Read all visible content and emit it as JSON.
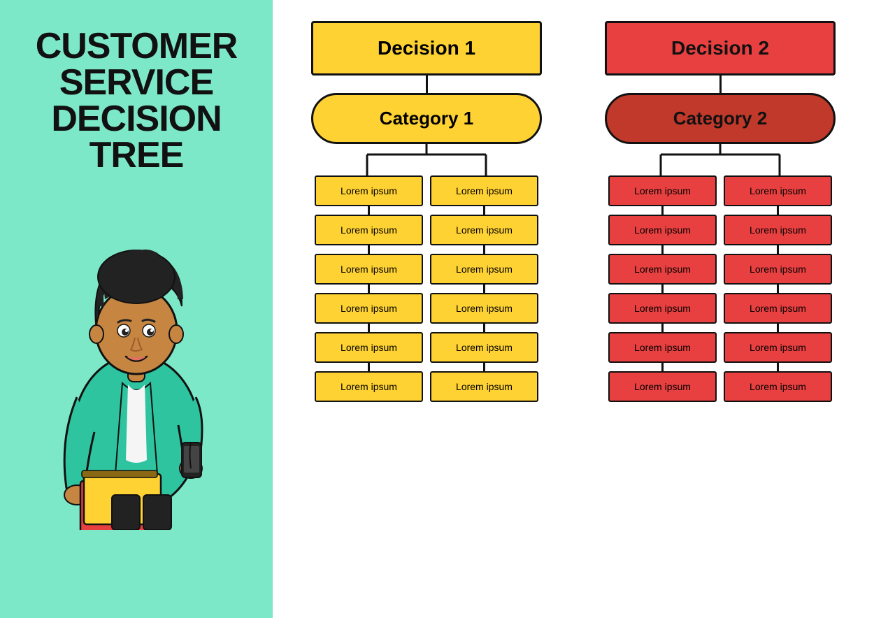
{
  "title": {
    "line1": "CUSTOMER",
    "line2": "SERVICE",
    "line3": "DECISION",
    "line4": "TREE"
  },
  "tree": {
    "decision1": {
      "label": "Decision 1",
      "category": "Category 1",
      "color": "yellow",
      "col1_items": [
        "Lorem ipsum",
        "Lorem ipsum",
        "Lorem ipsum",
        "Lorem ipsum",
        "Lorem ipsum",
        "Lorem ipsum"
      ],
      "col2_items": [
        "Lorem ipsum",
        "Lorem ipsum",
        "Lorem ipsum",
        "Lorem ipsum",
        "Lorem ipsum",
        "Lorem ipsum"
      ]
    },
    "decision2": {
      "label": "Decision 2",
      "category": "Category 2",
      "color": "red",
      "col1_items": [
        "Lorem ipsum",
        "Lorem ipsum",
        "Lorem ipsum",
        "Lorem ipsum",
        "Lorem ipsum",
        "Lorem ipsum"
      ],
      "col2_items": [
        "Lorem ipsum",
        "Lorem ipsum",
        "Lorem ipsum",
        "Lorem ipsum",
        "Lorem ipsum",
        "Lorem ipsum"
      ]
    }
  }
}
